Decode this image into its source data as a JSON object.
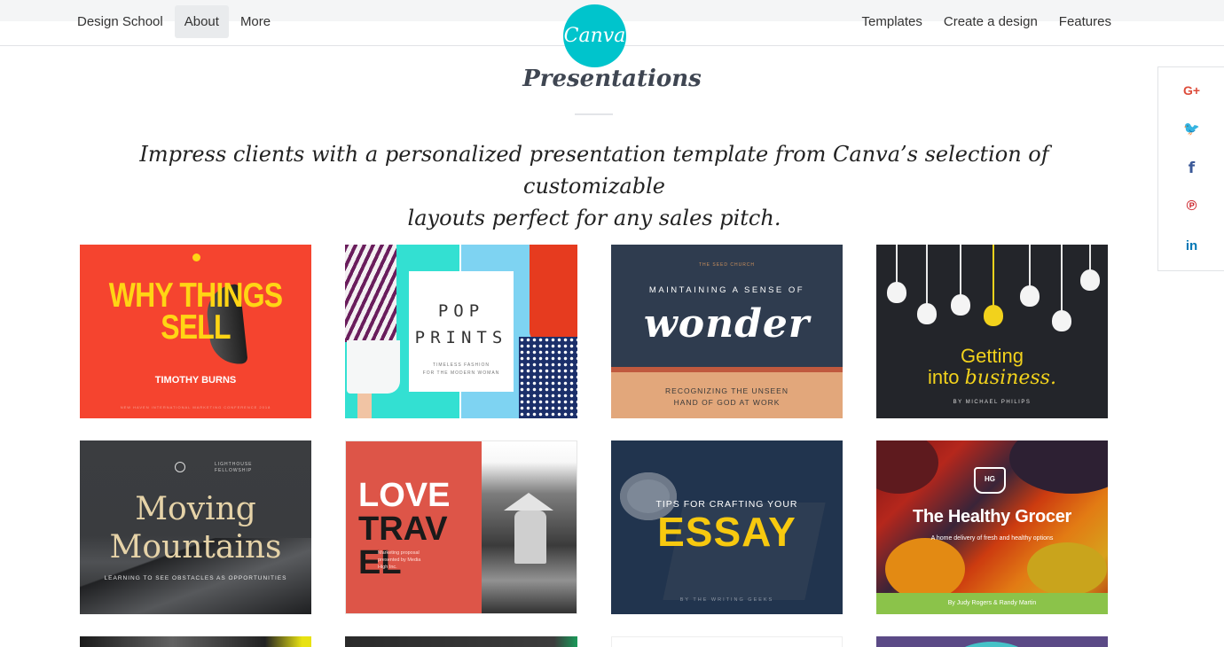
{
  "nav": {
    "left": [
      "Design School",
      "About",
      "More"
    ],
    "active_index": 1,
    "right": [
      "Templates",
      "Create a design",
      "Features"
    ],
    "logo_text": "Canva"
  },
  "heading": {
    "title": "Presentations",
    "intro_line1": "Impress clients with a personalized presentation template from Canva’s selection of customizable",
    "intro_line2": "layouts perfect for any sales pitch."
  },
  "cards": {
    "c1": {
      "title": "WHY THINGS SELL",
      "author": "TIMOTHY BURNS",
      "footer": "NEW HAVEN INTERNATIONAL MARKETING CONFERENCE 2018"
    },
    "c2": {
      "title_1": "POP",
      "title_2": "PRINTS",
      "sub_1": "TIMELESS FASHION",
      "sub_2": "FOR THE MODERN WOMAN"
    },
    "c3": {
      "org": "THE SEED CHURCH",
      "kicker": "MAINTAINING A SENSE OF",
      "big": "wonder",
      "sub_1": "RECOGNIZING THE UNSEEN",
      "sub_2": "HAND OF GOD AT WORK"
    },
    "c4": {
      "line1": "Getting",
      "line2a": "into ",
      "line2b": "business.",
      "by": "BY MICHAEL PHILIPS"
    },
    "c5": {
      "org": "LIGHTHOUSE FELLOWSHIP",
      "title_1": "Moving",
      "title_2": "Mountains",
      "sub": "LEARNING TO SEE OBSTACLES AS OPPORTUNITIES"
    },
    "c6": {
      "w1": "LOVE",
      "b1": "TRAV",
      "b2": "EL",
      "desc_1": "Marketing proposal",
      "desc_2": "presented by Media",
      "desc_3": "High Inc."
    },
    "c7": {
      "kicker": "TIPS FOR CRAFTING YOUR",
      "big": "ESSAY",
      "by": "BY THE WRITING GEEKS"
    },
    "c8": {
      "logo": "HG",
      "name": "The Healthy Grocer",
      "tag": "A home delivery of fresh and healthy options",
      "footer": "By Judy Rogers & Randy Martin"
    }
  },
  "social": {
    "icons": [
      "google-plus-icon",
      "twitter-icon",
      "facebook-icon",
      "pinterest-icon",
      "linkedin-icon"
    ],
    "glyphs": [
      "G+",
      "🐦",
      "f",
      "℗",
      "in"
    ],
    "colors": [
      "#dd4b39",
      "#55acee",
      "#3b5998",
      "#cb2027",
      "#0077b5"
    ]
  },
  "colors": {
    "brand": "#00c4cc"
  }
}
